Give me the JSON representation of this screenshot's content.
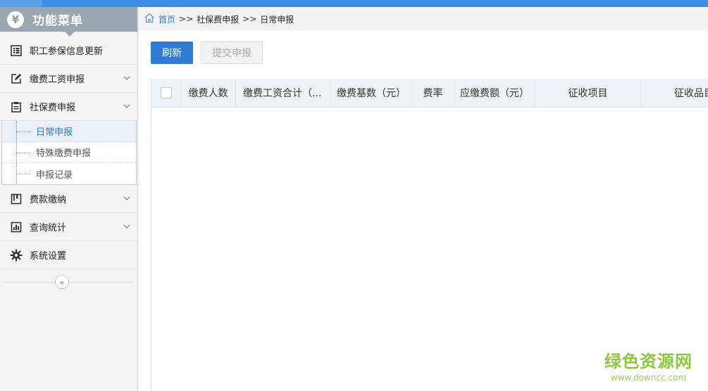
{
  "header": {
    "menu_title": "功能菜单",
    "menu_icon_glyph": "¥"
  },
  "sidebar": {
    "items": [
      {
        "label": "职工参保信息更新",
        "icon": "list-icon"
      },
      {
        "label": "缴费工资申报",
        "icon": "edit-icon",
        "expandable": true
      },
      {
        "label": "社保费申报",
        "icon": "clipboard-icon",
        "expandable": true,
        "expanded": true,
        "children": [
          {
            "label": "日常申报",
            "active": true
          },
          {
            "label": "特殊缴费申报"
          },
          {
            "label": "申报记录"
          }
        ]
      },
      {
        "label": "费款缴纳",
        "icon": "book-icon",
        "expandable": true
      },
      {
        "label": "查询统计",
        "icon": "chart-icon",
        "expandable": true
      },
      {
        "label": "系统设置",
        "icon": "gear-icon"
      }
    ],
    "collapse_glyph": "«"
  },
  "breadcrumb": {
    "home": "首页",
    "sep": ">>",
    "level1": "社保费申报",
    "level2": "日常申报"
  },
  "toolbar": {
    "refresh_label": "刷新",
    "submit_label": "提交申报"
  },
  "grid": {
    "columns": [
      "缴费人数",
      "缴费工资合计（...",
      "缴费基数（元）",
      "费率",
      "应缴费额（元）",
      "征收项目",
      "征收品目"
    ]
  },
  "watermark": {
    "cn": "绿色资源网",
    "en": "www.downcc.com"
  },
  "colors": {
    "accent": "#2f7bd6",
    "topbar": "#3d8ee6",
    "menu_header": "#9aa6b2",
    "active_link": "#2a7bc7"
  }
}
